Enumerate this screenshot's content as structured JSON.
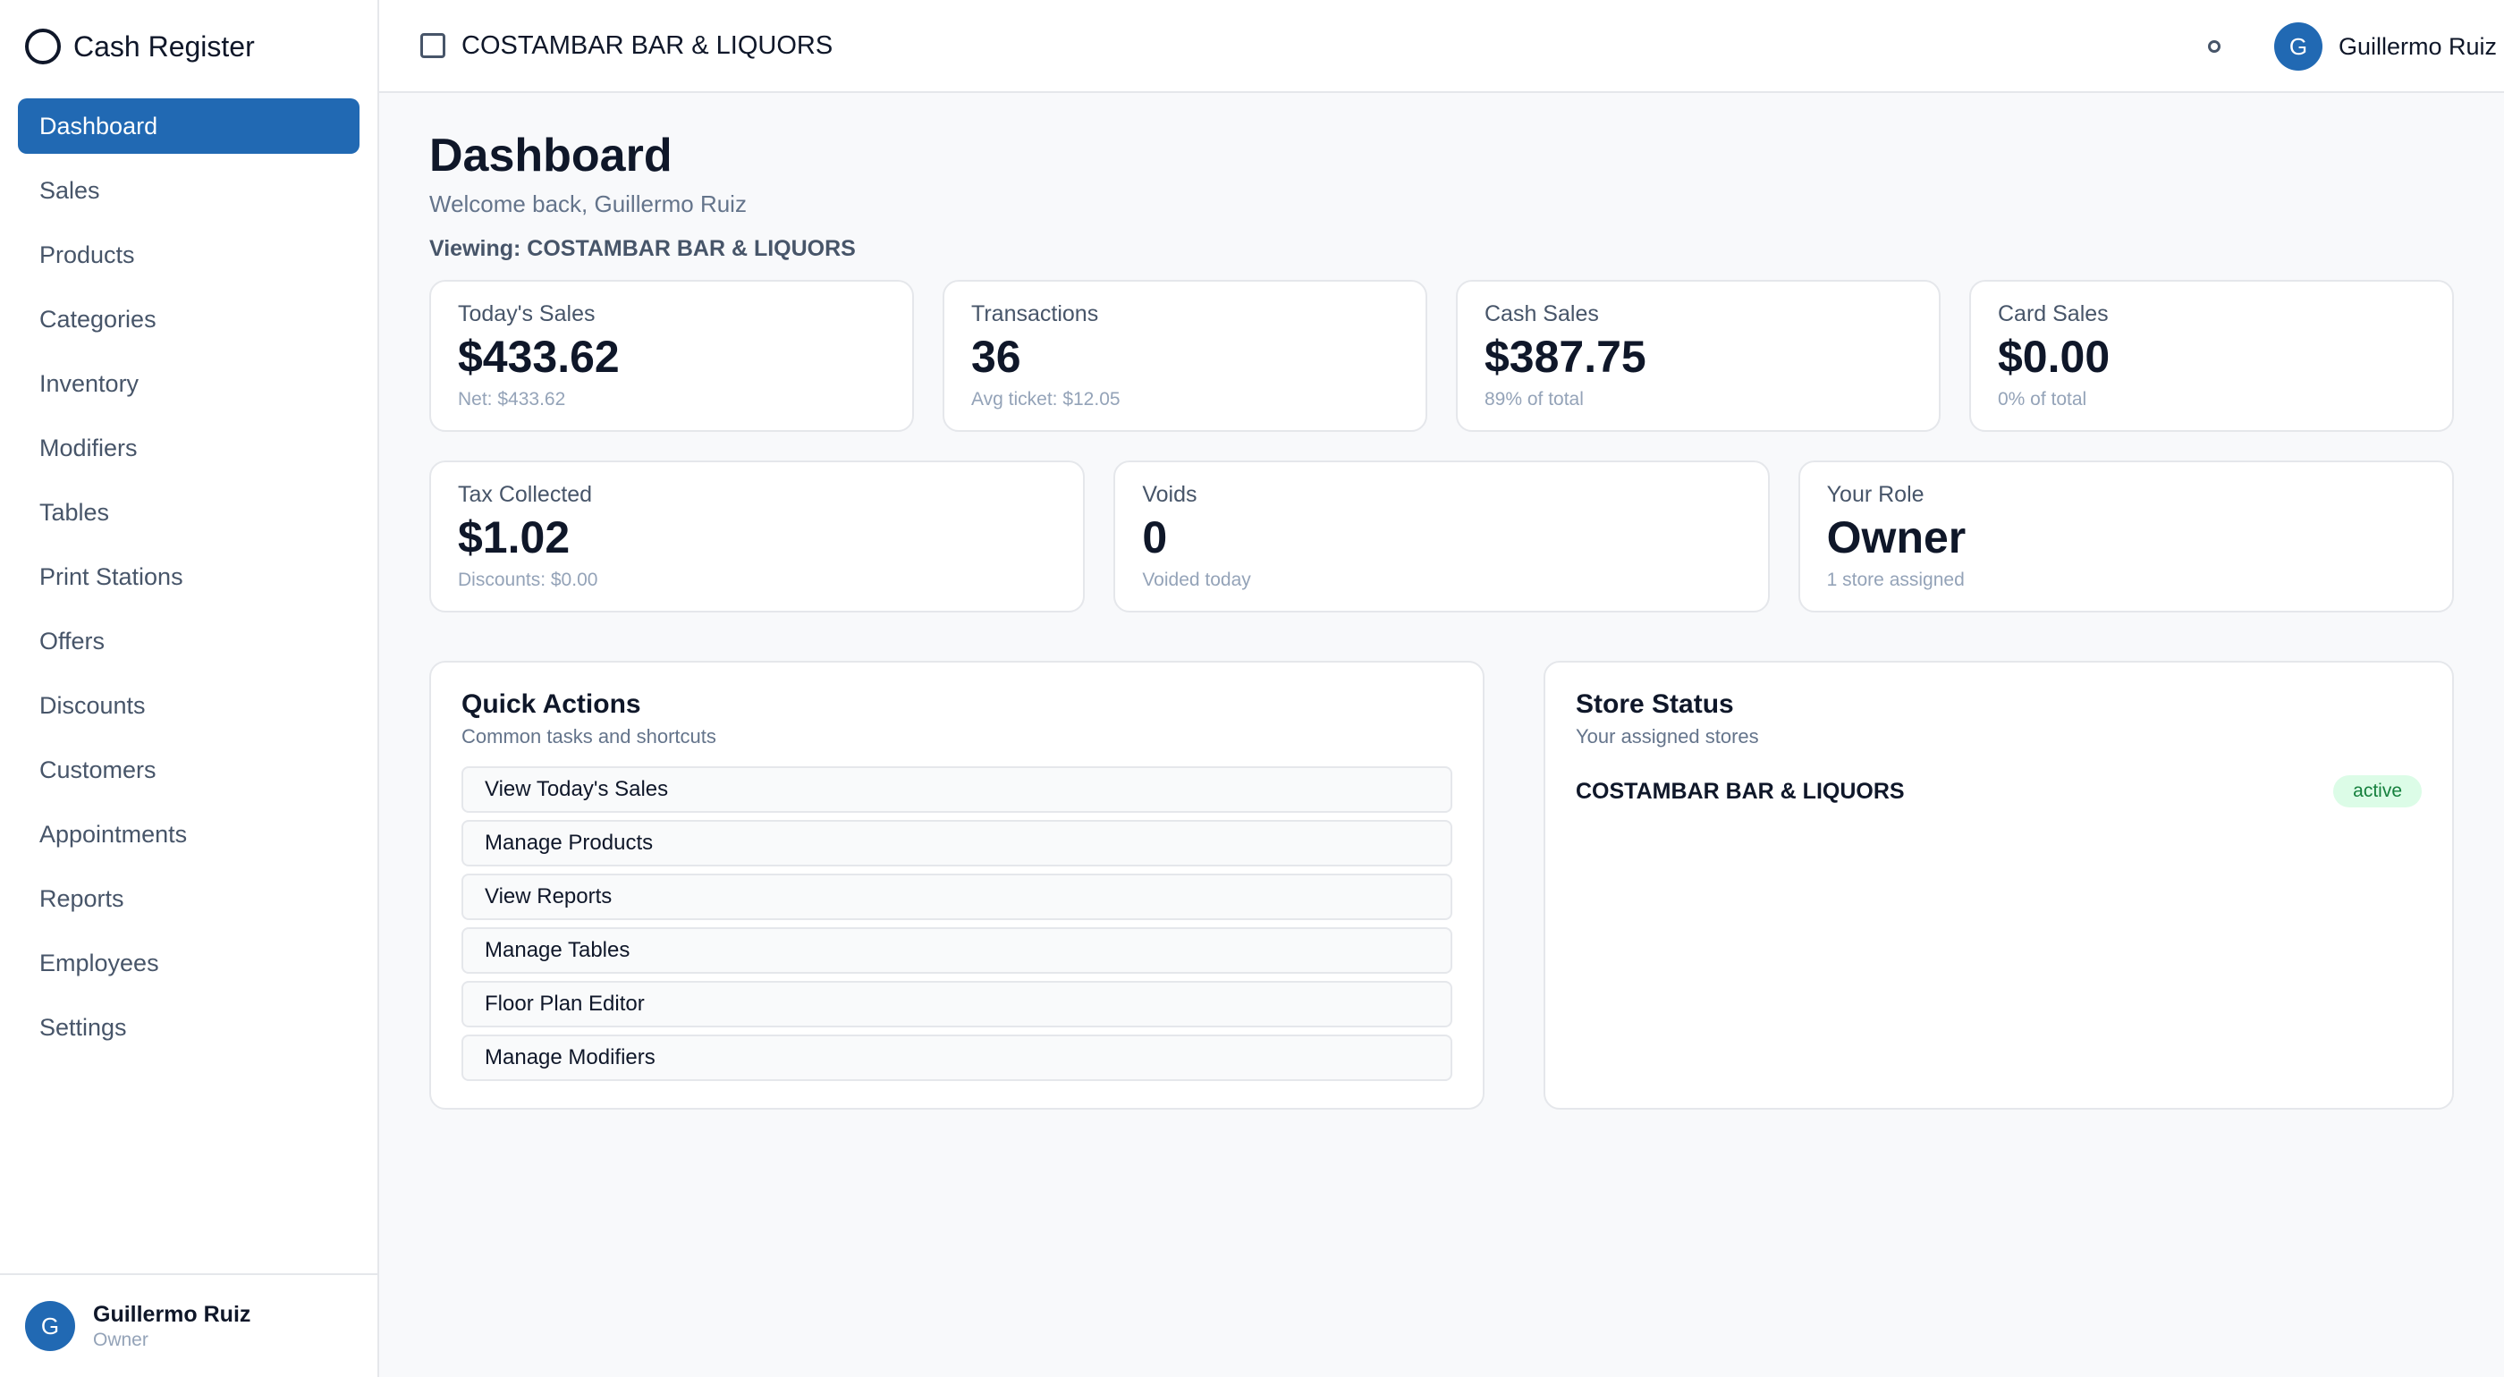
{
  "app": {
    "title": "Cash Register"
  },
  "sidebar": {
    "items": [
      {
        "label": "Dashboard",
        "active": true
      },
      {
        "label": "Sales"
      },
      {
        "label": "Products"
      },
      {
        "label": "Categories"
      },
      {
        "label": "Inventory"
      },
      {
        "label": "Modifiers"
      },
      {
        "label": "Tables"
      },
      {
        "label": "Print Stations"
      },
      {
        "label": "Offers"
      },
      {
        "label": "Discounts"
      },
      {
        "label": "Customers"
      },
      {
        "label": "Appointments"
      },
      {
        "label": "Reports"
      },
      {
        "label": "Employees"
      },
      {
        "label": "Settings"
      }
    ],
    "user": {
      "initial": "G",
      "name": "Guillermo Ruiz",
      "role": "Owner"
    }
  },
  "topbar": {
    "store": "COSTAMBAR BAR & LIQUORS",
    "user_initial": "G",
    "user_name": "Guillermo Ruiz"
  },
  "page": {
    "title": "Dashboard",
    "welcome": "Welcome back, Guillermo Ruiz",
    "viewing": "Viewing: COSTAMBAR BAR & LIQUORS"
  },
  "stats": {
    "row1": [
      {
        "label": "Today's Sales",
        "value": "$433.62",
        "sub": "Net: $433.62"
      },
      {
        "label": "Transactions",
        "value": "36",
        "sub": "Avg ticket: $12.05"
      },
      {
        "label": "Cash Sales",
        "value": "$387.75",
        "sub": "89% of total"
      },
      {
        "label": "Card Sales",
        "value": "$0.00",
        "sub": "0% of total"
      }
    ],
    "row2": [
      {
        "label": "Tax Collected",
        "value": "$1.02",
        "sub": "Discounts: $0.00"
      },
      {
        "label": "Voids",
        "value": "0",
        "sub": "Voided today"
      },
      {
        "label": "Your Role",
        "value": "Owner",
        "sub": "1 store assigned"
      }
    ]
  },
  "quick_actions": {
    "title": "Quick Actions",
    "subtitle": "Common tasks and shortcuts",
    "items": [
      "View Today's Sales",
      "Manage Products",
      "View Reports",
      "Manage Tables",
      "Floor Plan Editor",
      "Manage Modifiers"
    ]
  },
  "store_status": {
    "title": "Store Status",
    "subtitle": "Your assigned stores",
    "stores": [
      {
        "name": "COSTAMBAR BAR & LIQUORS",
        "status": "active"
      }
    ]
  },
  "colors": {
    "accent": "#2169b3",
    "active_badge_bg": "#dcfce7",
    "active_badge_text": "#15803d"
  }
}
